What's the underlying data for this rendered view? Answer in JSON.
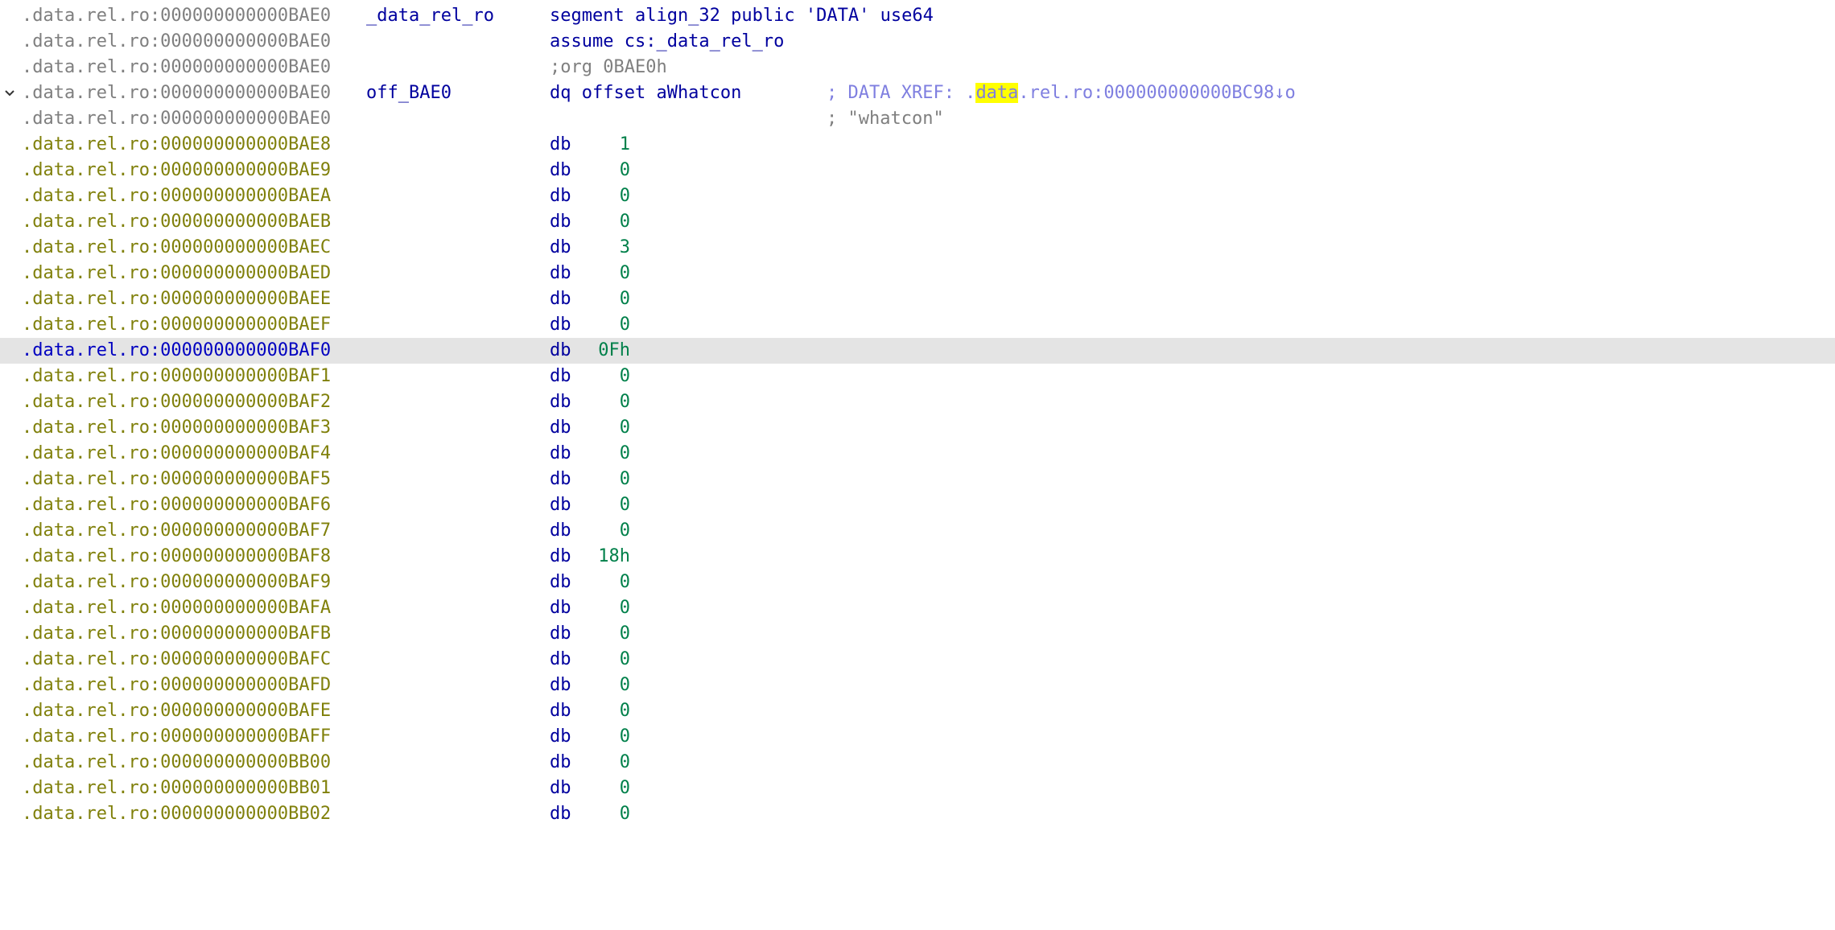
{
  "colors": {
    "address_default": "#80800b",
    "address_header": "#7f7f7f",
    "address_selected": "#0000c0",
    "instruction": "#00009e",
    "number": "#00804a",
    "comment": "#7f7f7f",
    "xref": "#7f7fe0",
    "highlight": "#ffff00",
    "selected_row_bg": "#e4e4e4"
  },
  "header": [
    {
      "address": ".data.rel.ro:000000000000BAE0",
      "label": "_data_rel_ro",
      "instruction": "segment align_32 public 'DATA' use64",
      "comment": ""
    },
    {
      "address": ".data.rel.ro:000000000000BAE0",
      "label": "",
      "instruction": "assume cs:_data_rel_ro",
      "comment": ""
    },
    {
      "address": ".data.rel.ro:000000000000BAE0",
      "label": "",
      "instruction": "",
      "comment": ";org 0BAE0h"
    },
    {
      "address": ".data.rel.ro:000000000000BAE0",
      "label": "off_BAE0",
      "instruction": "dq offset aWhatcon",
      "comment_xref_prefix": "; DATA XREF: .",
      "comment_xref_highlight": "data",
      "comment_xref_suffix": ".rel.ro:000000000000BC98↓o",
      "collapse_icon": "chevron-down-icon"
    },
    {
      "address": ".data.rel.ro:000000000000BAE0",
      "label": "",
      "instruction": "",
      "comment": "; \"whatcon\""
    }
  ],
  "data_rows": [
    {
      "address": ".data.rel.ro:000000000000BAE8",
      "mnemonic": "db",
      "value": "1"
    },
    {
      "address": ".data.rel.ro:000000000000BAE9",
      "mnemonic": "db",
      "value": "0"
    },
    {
      "address": ".data.rel.ro:000000000000BAEA",
      "mnemonic": "db",
      "value": "0"
    },
    {
      "address": ".data.rel.ro:000000000000BAEB",
      "mnemonic": "db",
      "value": "0"
    },
    {
      "address": ".data.rel.ro:000000000000BAEC",
      "mnemonic": "db",
      "value": "3"
    },
    {
      "address": ".data.rel.ro:000000000000BAED",
      "mnemonic": "db",
      "value": "0"
    },
    {
      "address": ".data.rel.ro:000000000000BAEE",
      "mnemonic": "db",
      "value": "0"
    },
    {
      "address": ".data.rel.ro:000000000000BAEF",
      "mnemonic": "db",
      "value": "0"
    },
    {
      "address": ".data.rel.ro:000000000000BAF0",
      "mnemonic": "db",
      "value": "0Fh",
      "selected": true
    },
    {
      "address": ".data.rel.ro:000000000000BAF1",
      "mnemonic": "db",
      "value": "0"
    },
    {
      "address": ".data.rel.ro:000000000000BAF2",
      "mnemonic": "db",
      "value": "0"
    },
    {
      "address": ".data.rel.ro:000000000000BAF3",
      "mnemonic": "db",
      "value": "0"
    },
    {
      "address": ".data.rel.ro:000000000000BAF4",
      "mnemonic": "db",
      "value": "0"
    },
    {
      "address": ".data.rel.ro:000000000000BAF5",
      "mnemonic": "db",
      "value": "0"
    },
    {
      "address": ".data.rel.ro:000000000000BAF6",
      "mnemonic": "db",
      "value": "0"
    },
    {
      "address": ".data.rel.ro:000000000000BAF7",
      "mnemonic": "db",
      "value": "0"
    },
    {
      "address": ".data.rel.ro:000000000000BAF8",
      "mnemonic": "db",
      "value": "18h"
    },
    {
      "address": ".data.rel.ro:000000000000BAF9",
      "mnemonic": "db",
      "value": "0"
    },
    {
      "address": ".data.rel.ro:000000000000BAFA",
      "mnemonic": "db",
      "value": "0"
    },
    {
      "address": ".data.rel.ro:000000000000BAFB",
      "mnemonic": "db",
      "value": "0"
    },
    {
      "address": ".data.rel.ro:000000000000BAFC",
      "mnemonic": "db",
      "value": "0"
    },
    {
      "address": ".data.rel.ro:000000000000BAFD",
      "mnemonic": "db",
      "value": "0"
    },
    {
      "address": ".data.rel.ro:000000000000BAFE",
      "mnemonic": "db",
      "value": "0"
    },
    {
      "address": ".data.rel.ro:000000000000BAFF",
      "mnemonic": "db",
      "value": "0"
    },
    {
      "address": ".data.rel.ro:000000000000BB00",
      "mnemonic": "db",
      "value": "0"
    },
    {
      "address": ".data.rel.ro:000000000000BB01",
      "mnemonic": "db",
      "value": "0"
    },
    {
      "address": ".data.rel.ro:000000000000BB02",
      "mnemonic": "db",
      "value": "0"
    }
  ]
}
